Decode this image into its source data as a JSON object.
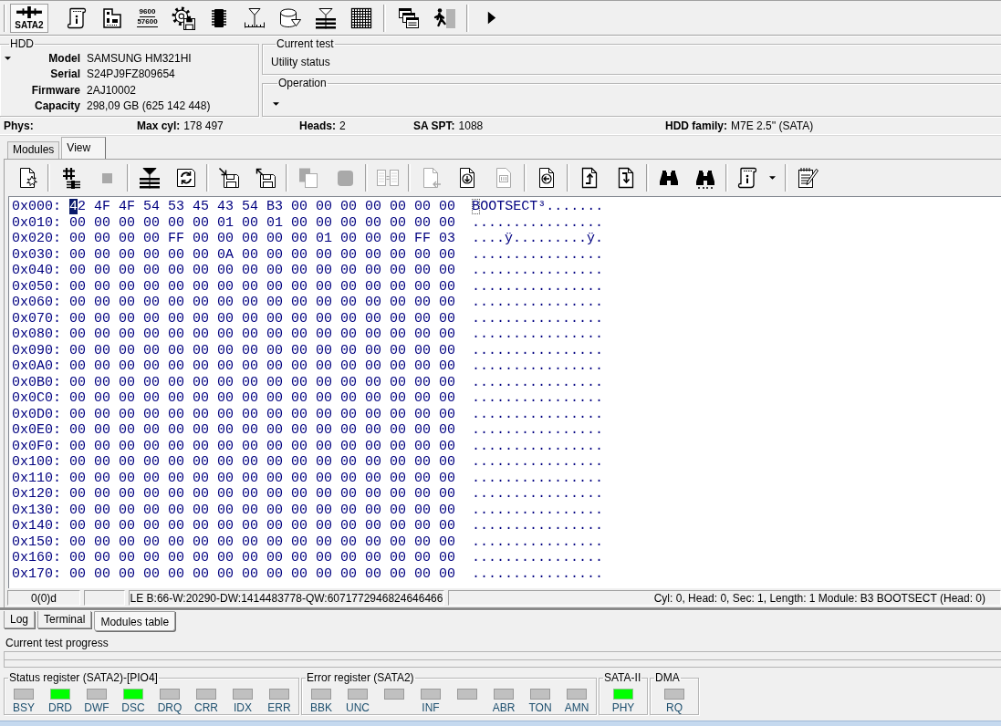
{
  "main_toolbar": [
    {
      "kind": "port",
      "label": "SATA2",
      "pressed": true
    },
    {
      "kind": "scroll"
    },
    {
      "kind": "board"
    },
    {
      "kind": "baud",
      "lines": [
        "9600",
        "57600"
      ]
    },
    {
      "kind": "gear_disk"
    },
    {
      "kind": "chip"
    },
    {
      "kind": "ruler"
    },
    {
      "kind": "cylinder"
    },
    {
      "kind": "heads"
    },
    {
      "kind": "grid"
    },
    {
      "kind": "separator"
    },
    {
      "kind": "windows"
    },
    {
      "kind": "exit"
    },
    {
      "kind": "separator"
    },
    {
      "kind": "more"
    }
  ],
  "hdd": {
    "title": "HDD",
    "fields": [
      {
        "label": "Model",
        "value": "SAMSUNG HM321HI"
      },
      {
        "label": "Serial",
        "value": "S24PJ9FZ809654"
      },
      {
        "label": "Firmware",
        "value": "2AJ10002"
      },
      {
        "label": "Capacity",
        "value": "298,09 GB (625 142 448)"
      }
    ]
  },
  "current_test": {
    "title": "Current test",
    "status": "Utility status"
  },
  "operation": {
    "title": "Operation"
  },
  "phys": {
    "label": "Phys:",
    "items": [
      {
        "label": "Max cyl:",
        "value": "178 497"
      },
      {
        "label": "Heads:",
        "value": "2"
      },
      {
        "label": "SA SPT:",
        "value": "1088"
      },
      {
        "label": "HDD family:",
        "value": "M7E 2.5'' (SATA)"
      }
    ]
  },
  "tabs": [
    {
      "label": "Modules",
      "selected": false
    },
    {
      "label": "View",
      "selected": true
    }
  ],
  "view_toolbar": [
    {
      "kind": "open",
      "disabled": false
    },
    {
      "kind": "separator"
    },
    {
      "kind": "hash",
      "disabled": false
    },
    {
      "kind": "stop",
      "disabled": true
    },
    {
      "kind": "separator"
    },
    {
      "kind": "marker",
      "disabled": false
    },
    {
      "kind": "refresh",
      "disabled": false
    },
    {
      "kind": "separator"
    },
    {
      "kind": "load",
      "disabled": false
    },
    {
      "kind": "save",
      "disabled": false
    },
    {
      "kind": "separator"
    },
    {
      "kind": "copy",
      "disabled": true
    },
    {
      "kind": "block",
      "disabled": true
    },
    {
      "kind": "separator"
    },
    {
      "kind": "compare",
      "disabled": true
    },
    {
      "kind": "separator"
    },
    {
      "kind": "page_out",
      "disabled": true
    },
    {
      "kind": "page_down",
      "disabled": false
    },
    {
      "kind": "numbers",
      "disabled": true
    },
    {
      "kind": "separator"
    },
    {
      "kind": "page_back",
      "disabled": false
    },
    {
      "kind": "separator"
    },
    {
      "kind": "top",
      "disabled": false
    },
    {
      "kind": "bottom",
      "disabled": false
    },
    {
      "kind": "separator"
    },
    {
      "kind": "find",
      "disabled": false
    },
    {
      "kind": "find_next",
      "disabled": false
    },
    {
      "kind": "separator"
    },
    {
      "kind": "info_menu",
      "disabled": false
    },
    {
      "kind": "separator"
    },
    {
      "kind": "notes",
      "disabled": false
    }
  ],
  "hex_rows": [
    {
      "offset": "0x000:",
      "bytes": "42 4F 4F 54 53 45 43 54 B3 00 00 00 00 00 00 00",
      "ascii": "BOOTSECT³.......",
      "cursor": true
    },
    {
      "offset": "0x010:",
      "bytes": "00 00 00 00 00 00 01 00 01 00 00 00 00 00 00 00",
      "ascii": "................",
      "cursor": false
    },
    {
      "offset": "0x020:",
      "bytes": "00 00 00 00 FF 00 00 00 00 00 01 00 00 00 FF 03",
      "ascii": "....ÿ.........ÿ.",
      "cursor": false
    },
    {
      "offset": "0x030:",
      "bytes": "00 00 00 00 00 00 0A 00 00 00 00 00 00 00 00 00",
      "ascii": "................",
      "cursor": false
    },
    {
      "offset": "0x040:",
      "bytes": "00 00 00 00 00 00 00 00 00 00 00 00 00 00 00 00",
      "ascii": "................",
      "cursor": false
    },
    {
      "offset": "0x050:",
      "bytes": "00 00 00 00 00 00 00 00 00 00 00 00 00 00 00 00",
      "ascii": "................",
      "cursor": false
    },
    {
      "offset": "0x060:",
      "bytes": "00 00 00 00 00 00 00 00 00 00 00 00 00 00 00 00",
      "ascii": "................",
      "cursor": false
    },
    {
      "offset": "0x070:",
      "bytes": "00 00 00 00 00 00 00 00 00 00 00 00 00 00 00 00",
      "ascii": "................",
      "cursor": false
    },
    {
      "offset": "0x080:",
      "bytes": "00 00 00 00 00 00 00 00 00 00 00 00 00 00 00 00",
      "ascii": "................",
      "cursor": false
    },
    {
      "offset": "0x090:",
      "bytes": "00 00 00 00 00 00 00 00 00 00 00 00 00 00 00 00",
      "ascii": "................",
      "cursor": false
    },
    {
      "offset": "0x0A0:",
      "bytes": "00 00 00 00 00 00 00 00 00 00 00 00 00 00 00 00",
      "ascii": "................",
      "cursor": false
    },
    {
      "offset": "0x0B0:",
      "bytes": "00 00 00 00 00 00 00 00 00 00 00 00 00 00 00 00",
      "ascii": "................",
      "cursor": false
    },
    {
      "offset": "0x0C0:",
      "bytes": "00 00 00 00 00 00 00 00 00 00 00 00 00 00 00 00",
      "ascii": "................",
      "cursor": false
    },
    {
      "offset": "0x0D0:",
      "bytes": "00 00 00 00 00 00 00 00 00 00 00 00 00 00 00 00",
      "ascii": "................",
      "cursor": false
    },
    {
      "offset": "0x0E0:",
      "bytes": "00 00 00 00 00 00 00 00 00 00 00 00 00 00 00 00",
      "ascii": "................",
      "cursor": false
    },
    {
      "offset": "0x0F0:",
      "bytes": "00 00 00 00 00 00 00 00 00 00 00 00 00 00 00 00",
      "ascii": "................",
      "cursor": false
    },
    {
      "offset": "0x100:",
      "bytes": "00 00 00 00 00 00 00 00 00 00 00 00 00 00 00 00",
      "ascii": "................",
      "cursor": false
    },
    {
      "offset": "0x110:",
      "bytes": "00 00 00 00 00 00 00 00 00 00 00 00 00 00 00 00",
      "ascii": "................",
      "cursor": false
    },
    {
      "offset": "0x120:",
      "bytes": "00 00 00 00 00 00 00 00 00 00 00 00 00 00 00 00",
      "ascii": "................",
      "cursor": false
    },
    {
      "offset": "0x130:",
      "bytes": "00 00 00 00 00 00 00 00 00 00 00 00 00 00 00 00",
      "ascii": "................",
      "cursor": false
    },
    {
      "offset": "0x140:",
      "bytes": "00 00 00 00 00 00 00 00 00 00 00 00 00 00 00 00",
      "ascii": "................",
      "cursor": false
    },
    {
      "offset": "0x150:",
      "bytes": "00 00 00 00 00 00 00 00 00 00 00 00 00 00 00 00",
      "ascii": "................",
      "cursor": false
    },
    {
      "offset": "0x160:",
      "bytes": "00 00 00 00 00 00 00 00 00 00 00 00 00 00 00 00",
      "ascii": "................",
      "cursor": false
    },
    {
      "offset": "0x170:",
      "bytes": "00 00 00 00 00 00 00 00 00 00 00 00 00 00 00 00",
      "ascii": "................",
      "cursor": false
    }
  ],
  "status_bar": [
    {
      "kind": "text",
      "text": "0(0)d"
    },
    {
      "kind": "blank"
    },
    {
      "kind": "text",
      "text": "LE B:66-W:20290-DW:1414483778-QW:6071772946824646466"
    },
    {
      "kind": "text",
      "text": "Cyl: 0, Head: 0, Sec: 1, Length: 1 Module: B3 BOOTSECT (Head: 0)"
    }
  ],
  "bottom_tabs": [
    {
      "label": "Log",
      "selected": false
    },
    {
      "label": "Terminal",
      "selected": false
    },
    {
      "label": "Modules table",
      "selected": true
    }
  ],
  "progress": {
    "label": "Current test progress"
  },
  "registers": [
    {
      "title": "Status register (SATA2)-[PIO4]",
      "leds": [
        {
          "label": "BSY",
          "on": false
        },
        {
          "label": "DRD",
          "on": true
        },
        {
          "label": "DWF",
          "on": false
        },
        {
          "label": "DSC",
          "on": true
        },
        {
          "label": "DRQ",
          "on": false
        },
        {
          "label": "CRR",
          "on": false
        },
        {
          "label": "IDX",
          "on": false
        },
        {
          "label": "ERR",
          "on": false
        }
      ]
    },
    {
      "title": "Error register (SATA2)",
      "leds": [
        {
          "label": "BBK",
          "on": false
        },
        {
          "label": "UNC",
          "on": false
        },
        {
          "on": false
        },
        {
          "label": "INF",
          "on": false
        },
        {
          "on": false
        },
        {
          "label": "ABR",
          "on": false
        },
        {
          "label": "TON",
          "on": false
        },
        {
          "label": "AMN",
          "on": false
        }
      ]
    },
    {
      "title": "SATA-II",
      "leds": [
        {
          "label": "PHY",
          "on": true
        }
      ]
    },
    {
      "title": "DMA",
      "leds": [
        {
          "label": "RQ",
          "on": false
        }
      ]
    }
  ]
}
